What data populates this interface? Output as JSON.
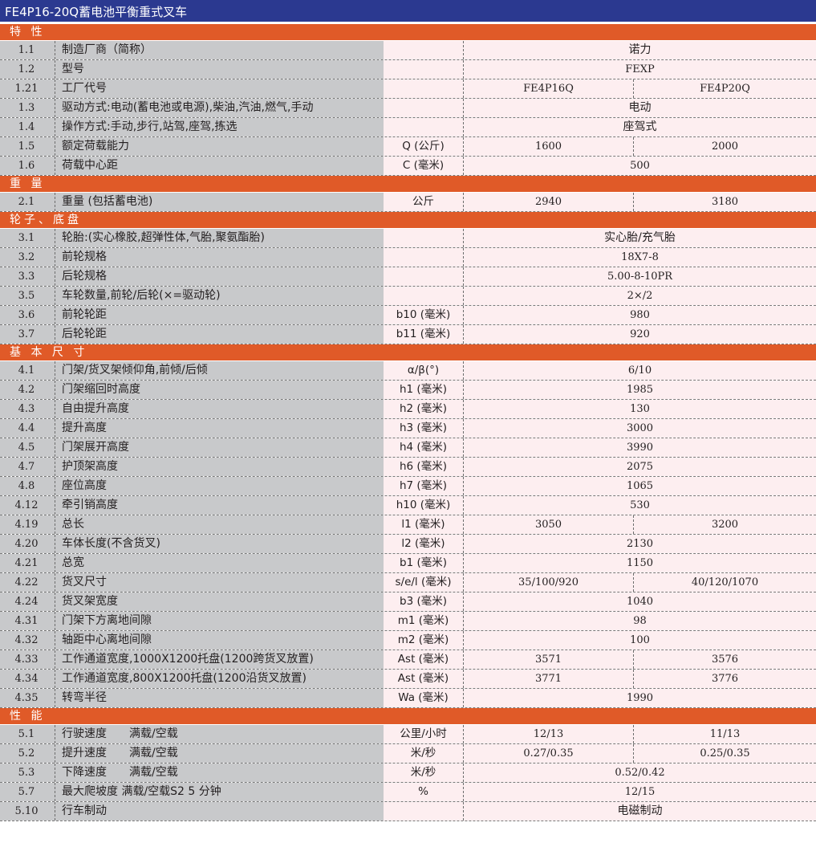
{
  "title": "FE4P16-20Q蓄电池平衡重式叉车",
  "colors": {
    "header": "#2b3990",
    "section": "#e05a28",
    "left_bg": "#c8c9cb",
    "right_bg": "#fdeef0"
  },
  "rows": [
    {
      "section": "特 性"
    },
    {
      "no": "1.1",
      "name": "制造厂商（简称）",
      "unit": "",
      "value": "诺力",
      "cjk": true
    },
    {
      "no": "1.2",
      "name": "型号",
      "unit": "",
      "value": "FEXP"
    },
    {
      "no": "1.21",
      "name": "工厂代号",
      "unit": "",
      "a": "FE4P16Q",
      "b": "FE4P20Q"
    },
    {
      "no": "1.3",
      "name": "驱动方式:电动(蓄电池或电源),柴油,汽油,燃气,手动",
      "unit": "",
      "value": "电动",
      "cjk": true
    },
    {
      "no": "1.4",
      "name": "操作方式:手动,步行,站驾,座驾,拣选",
      "unit": "",
      "value": "座驾式",
      "cjk": true
    },
    {
      "no": "1.5",
      "name": "额定荷载能力",
      "unit": "Q (公斤)",
      "a": "1600",
      "b": "2000"
    },
    {
      "no": "1.6",
      "name": "荷载中心距",
      "unit": "C (毫米)",
      "value": "500"
    },
    {
      "section": "重 量"
    },
    {
      "no": "2.1",
      "name": "重量 (包括蓄电池)",
      "unit": "公斤",
      "a": "2940",
      "b": "3180"
    },
    {
      "section": "轮子、底盘"
    },
    {
      "no": "3.1",
      "name": "轮胎:(实心橡胶,超弹性体,气胎,聚氨酯胎)",
      "unit": "",
      "value": "实心胎/充气胎",
      "cjk": true
    },
    {
      "no": "3.2",
      "name": "前轮规格",
      "unit": "",
      "value": "18X7-8"
    },
    {
      "no": "3.3",
      "name": "后轮规格",
      "unit": "",
      "value": "5.00-8-10PR"
    },
    {
      "no": "3.5",
      "name": "车轮数量,前轮/后轮(×=驱动轮)",
      "unit": "",
      "value": "2×/2"
    },
    {
      "no": "3.6",
      "name": "前轮轮距",
      "unit": "b10 (毫米)",
      "value": "980"
    },
    {
      "no": "3.7",
      "name": "后轮轮距",
      "unit": "b11 (毫米)",
      "value": "920"
    },
    {
      "section": "基 本 尺 寸"
    },
    {
      "no": "4.1",
      "name": "门架/货叉架倾仰角,前倾/后倾",
      "unit": "α/β(°)",
      "value": "6/10"
    },
    {
      "no": "4.2",
      "name": "门架缩回时高度",
      "unit": "h1 (毫米)",
      "value": "1985"
    },
    {
      "no": "4.3",
      "name": "自由提升高度",
      "unit": "h2 (毫米)",
      "value": "130"
    },
    {
      "no": "4.4",
      "name": "提升高度",
      "unit": "h3 (毫米)",
      "value": "3000"
    },
    {
      "no": "4.5",
      "name": "门架展开高度",
      "unit": "h4 (毫米)",
      "value": "3990"
    },
    {
      "no": "4.7",
      "name": "护顶架高度",
      "unit": "h6 (毫米)",
      "value": "2075"
    },
    {
      "no": "4.8",
      "name": "座位高度",
      "unit": "h7 (毫米)",
      "value": "1065"
    },
    {
      "no": "4.12",
      "name": "牵引销高度",
      "unit": "h10 (毫米)",
      "value": "530"
    },
    {
      "no": "4.19",
      "name": "总长",
      "unit": "l1 (毫米)",
      "a": "3050",
      "b": "3200"
    },
    {
      "no": "4.20",
      "name": "车体长度(不含货叉)",
      "unit": "l2 (毫米)",
      "value": "2130"
    },
    {
      "no": "4.21",
      "name": "总宽",
      "unit": "b1 (毫米)",
      "value": "1150"
    },
    {
      "no": "4.22",
      "name": "货叉尺寸",
      "unit": "s/e/l (毫米)",
      "a": "35/100/920",
      "b": "40/120/1070"
    },
    {
      "no": "4.24",
      "name": "货叉架宽度",
      "unit": "b3 (毫米)",
      "value": "1040"
    },
    {
      "no": "4.31",
      "name": "门架下方离地间隙",
      "unit": "m1 (毫米)",
      "value": "98"
    },
    {
      "no": "4.32",
      "name": "轴距中心离地间隙",
      "unit": "m2 (毫米)",
      "value": "100"
    },
    {
      "no": "4.33",
      "name": "工作通道宽度,1000X1200托盘(1200跨货叉放置)",
      "unit": "Ast (毫米)",
      "a": "3571",
      "b": "3576"
    },
    {
      "no": "4.34",
      "name": "工作通道宽度,800X1200托盘(1200沿货叉放置)",
      "unit": "Ast (毫米)",
      "a": "3771",
      "b": "3776"
    },
    {
      "no": "4.35",
      "name": "转弯半径",
      "unit": "Wa (毫米)",
      "value": "1990"
    },
    {
      "section": "性 能"
    },
    {
      "no": "5.1",
      "name": "行驶速度　　满载/空载",
      "unit": "公里/小时",
      "a": "12/13",
      "b": "11/13"
    },
    {
      "no": "5.2",
      "name": "提升速度　　满载/空载",
      "unit": "米/秒",
      "a": "0.27/0.35",
      "b": "0.25/0.35"
    },
    {
      "no": "5.3",
      "name": "下降速度　　满载/空载",
      "unit": "米/秒",
      "value": "0.52/0.42"
    },
    {
      "no": "5.7",
      "name": "最大爬坡度 满载/空载S2 5 分钟",
      "unit": "%",
      "value": "12/15"
    },
    {
      "no": "5.10",
      "name": "行车制动",
      "unit": "",
      "value": "电磁制动",
      "cjk": true
    }
  ]
}
